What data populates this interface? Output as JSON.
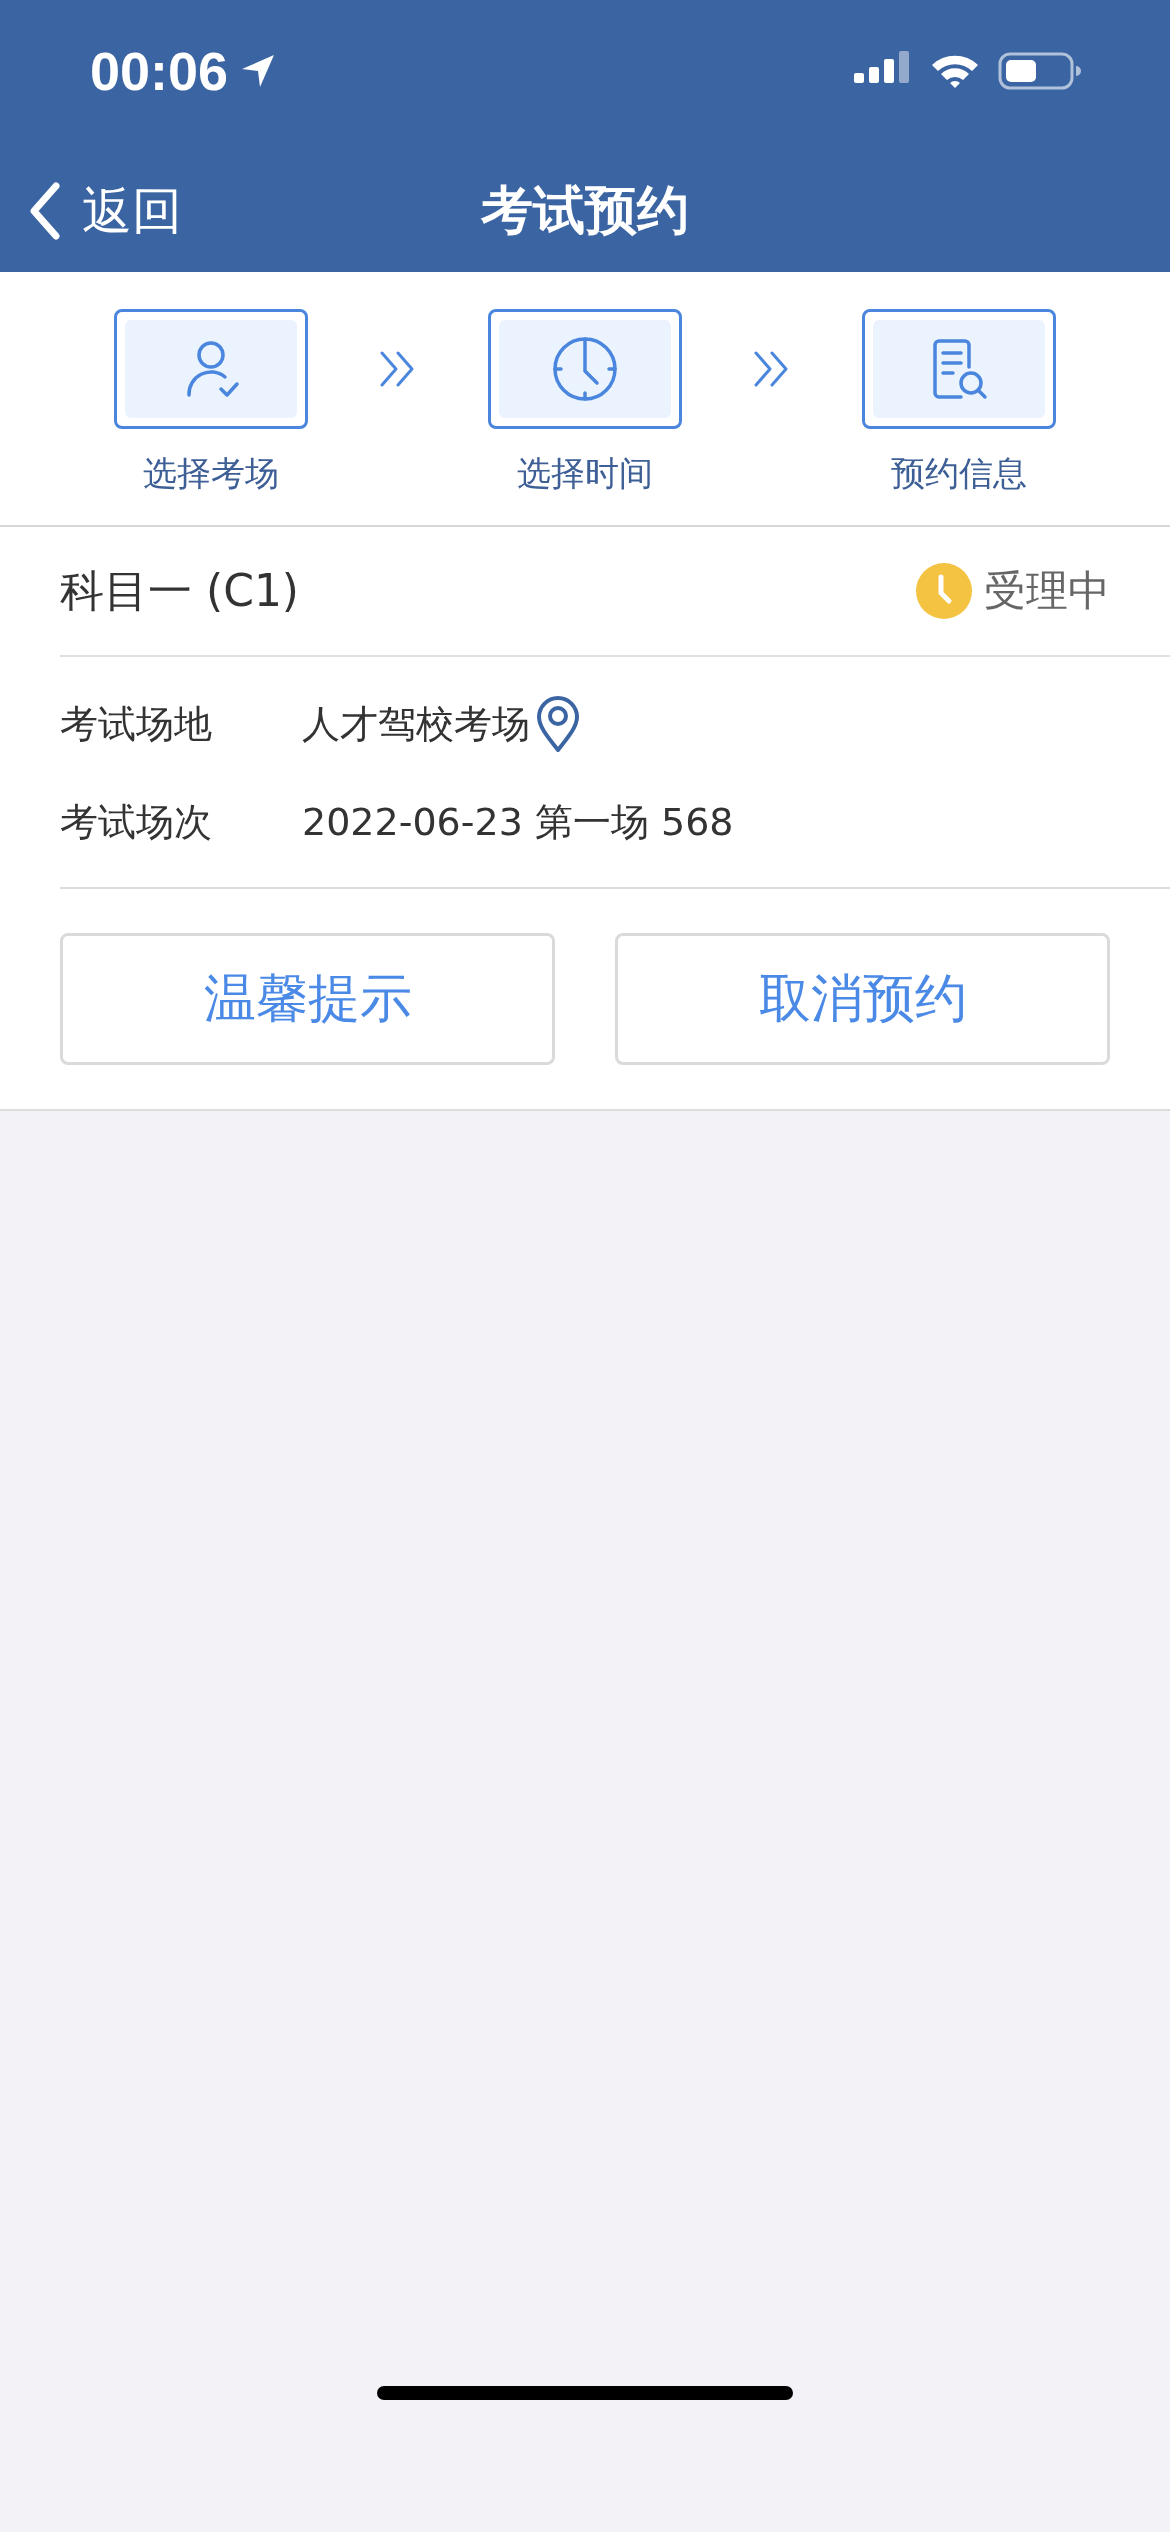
{
  "status_bar": {
    "time": "00:06"
  },
  "nav_bar": {
    "back_label": "返回",
    "title": "考试预约"
  },
  "steps": [
    {
      "kind": "person",
      "label": "选择考场"
    },
    {
      "kind": "clock",
      "label": "选择时间"
    },
    {
      "kind": "document",
      "label": "预约信息"
    }
  ],
  "booking": {
    "subject": "科目一 (C1)",
    "status": "受理中",
    "details": [
      {
        "kind": "place",
        "label": "考试场地",
        "value": "人才驾校考场"
      },
      {
        "kind": "plain",
        "label": "考试场次",
        "value": "2022-06-23 第一场 568"
      }
    ],
    "buttons": [
      "温馨提示",
      "取消预约"
    ]
  }
}
